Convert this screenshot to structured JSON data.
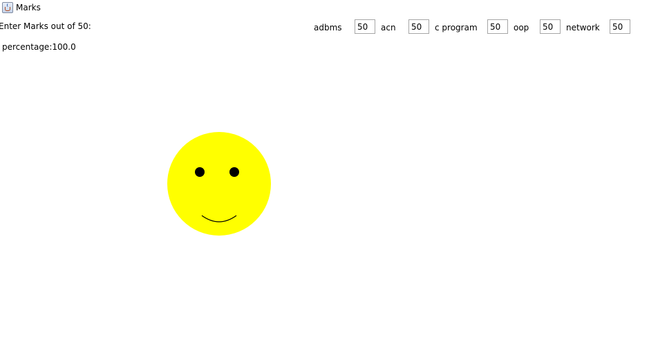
{
  "window": {
    "title": "Marks",
    "icon": "java-cup-icon"
  },
  "form": {
    "prompt": "Enter Marks out of 50:",
    "subjects": [
      {
        "label": "adbms",
        "value": "50"
      },
      {
        "label": "acn",
        "value": "50"
      },
      {
        "label": "c program",
        "value": "50"
      },
      {
        "label": "oop",
        "value": "50"
      },
      {
        "label": "network",
        "value": "50"
      }
    ]
  },
  "result": {
    "percentage_text": "percentage:100.0"
  },
  "smiley": {
    "face_color": "#ffff00",
    "eye_color": "#000000",
    "mouth_color": "#000000",
    "expression": "smile"
  }
}
